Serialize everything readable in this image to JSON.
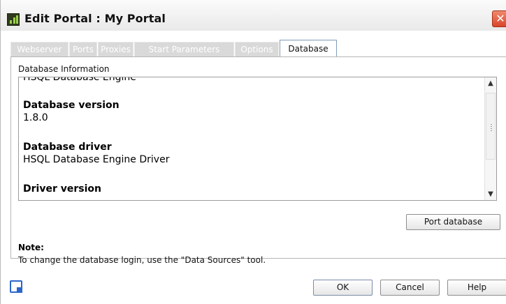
{
  "window": {
    "title": "Edit Portal  : My Portal",
    "close_glyph": "✕"
  },
  "tabs": [
    {
      "label": "Webserver",
      "active": false
    },
    {
      "label": "Ports",
      "active": false
    },
    {
      "label": "Proxies",
      "active": false
    },
    {
      "label": "Start Parameters",
      "active": false
    },
    {
      "label": "Options",
      "active": false
    },
    {
      "label": "Database",
      "active": true
    }
  ],
  "database_info": {
    "section_label": "Database Information",
    "top_partial_text": "HSQL Database Engine",
    "entries": [
      {
        "label": "Database version",
        "value": "1.8.0"
      },
      {
        "label": "Database driver",
        "value": "HSQL Database Engine Driver"
      },
      {
        "label": "Driver version",
        "value": ""
      }
    ],
    "scroll_up_icon": "chevron-up-icon",
    "scroll_down_icon": "chevron-down-icon"
  },
  "buttons": {
    "port_database": "Port database",
    "ok": "OK",
    "cancel": "Cancel",
    "help": "Help"
  },
  "note": {
    "label": "Note:",
    "text": "To change the database login, use the \"Data Sources\" tool."
  },
  "icons": {
    "app": "portal-app-icon",
    "footer": "edit-checkbox-icon"
  }
}
